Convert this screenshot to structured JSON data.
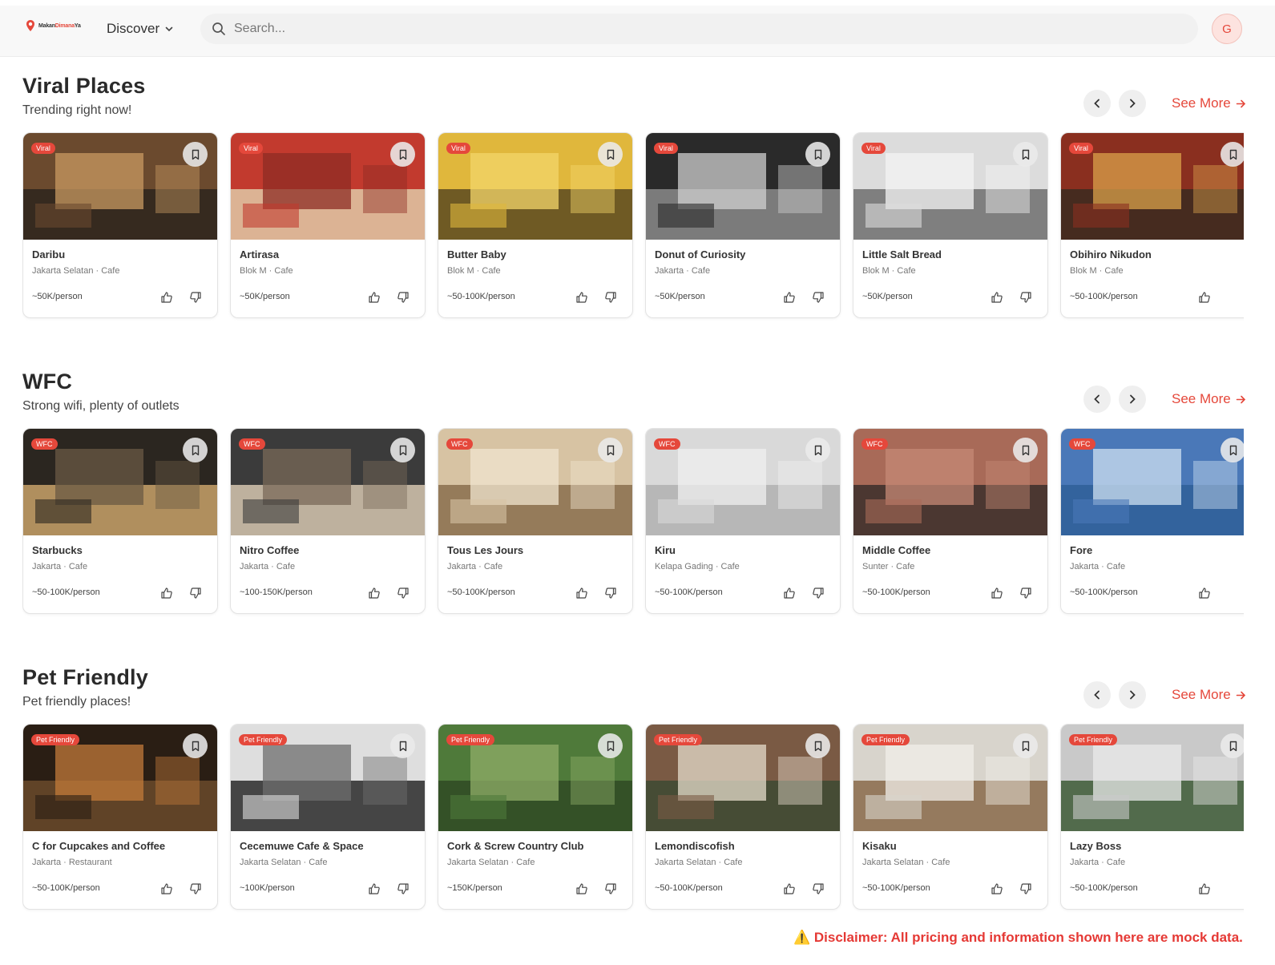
{
  "header": {
    "logo_text_a": "Makan",
    "logo_text_b": "Dimana",
    "logo_text_c": "Ya",
    "discover_label": "Discover",
    "search_placeholder": "Search...",
    "avatar_initial": "G"
  },
  "sections": [
    {
      "title": "Viral Places",
      "subtitle": "Trending right now!",
      "see_more": "See More",
      "cards": [
        {
          "name": "Daribu",
          "meta": "Jakarta Selatan · Cafe",
          "price": "~50K/person",
          "badge": "Viral"
        },
        {
          "name": "Artirasa",
          "meta": "Blok M · Cafe",
          "price": "~50K/person",
          "badge": "Viral"
        },
        {
          "name": "Butter Baby",
          "meta": "Blok M · Cafe",
          "price": "~50-100K/person",
          "badge": "Viral"
        },
        {
          "name": "Donut of Curiosity",
          "meta": "Jakarta · Cafe",
          "price": "~50K/person",
          "badge": "Viral"
        },
        {
          "name": "Little Salt Bread",
          "meta": "Blok M · Cafe",
          "price": "~50K/person",
          "badge": "Viral"
        },
        {
          "name": "Obihiro Nikudon",
          "meta": "Blok M · Cafe",
          "price": "~50-100K/person",
          "badge": "Viral"
        }
      ]
    },
    {
      "title": "WFC",
      "subtitle": "Strong wifi, plenty of outlets",
      "see_more": "See More",
      "cards": [
        {
          "name": "Starbucks",
          "meta": "Jakarta · Cafe",
          "price": "~50-100K/person",
          "badge": "WFC"
        },
        {
          "name": "Nitro Coffee",
          "meta": "Jakarta · Cafe",
          "price": "~100-150K/person",
          "badge": "WFC"
        },
        {
          "name": "Tous Les Jours",
          "meta": "Jakarta · Cafe",
          "price": "~50-100K/person",
          "badge": "WFC"
        },
        {
          "name": "Kiru",
          "meta": "Kelapa Gading · Cafe",
          "price": "~50-100K/person",
          "badge": "WFC"
        },
        {
          "name": "Middle Coffee",
          "meta": "Sunter · Cafe",
          "price": "~50-100K/person",
          "badge": "WFC"
        },
        {
          "name": "Fore",
          "meta": "Jakarta · Cafe",
          "price": "~50-100K/person",
          "badge": "WFC"
        }
      ]
    },
    {
      "title": "Pet Friendly",
      "subtitle": "Pet friendly places!",
      "see_more": "See More",
      "cards": [
        {
          "name": "C for Cupcakes and Coffee",
          "meta": "Jakarta · Restaurant",
          "price": "~50-100K/person",
          "badge": "Pet Friendly"
        },
        {
          "name": "Cecemuwe Cafe & Space",
          "meta": "Jakarta Selatan · Cafe",
          "price": "~100K/person",
          "badge": "Pet Friendly"
        },
        {
          "name": "Cork & Screw Country Club",
          "meta": "Jakarta Selatan · Cafe",
          "price": "~150K/person",
          "badge": "Pet Friendly"
        },
        {
          "name": "Lemondiscofish",
          "meta": "Jakarta Selatan · Cafe",
          "price": "~50-100K/person",
          "badge": "Pet Friendly"
        },
        {
          "name": "Kisaku",
          "meta": "Jakarta Selatan · Cafe",
          "price": "~50-100K/person",
          "badge": "Pet Friendly"
        },
        {
          "name": "Lazy Boss",
          "meta": "Jakarta · Cafe",
          "price": "~50-100K/person",
          "badge": "Pet Friendly"
        }
      ]
    }
  ],
  "disclaimer": "⚠️ Disclaimer: All pricing and information shown here are mock data.",
  "colors": {
    "accent": "#e5483b",
    "disclaimer": "#e53935"
  }
}
